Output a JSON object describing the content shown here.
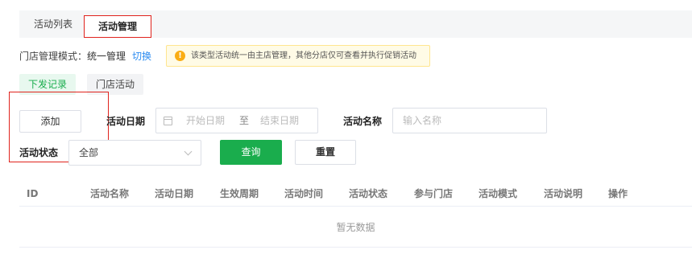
{
  "tabs": {
    "list": "活动列表",
    "manage": "活动管理"
  },
  "mode": {
    "label": "门店管理模式：",
    "value": "统一管理",
    "switch_link": "切换"
  },
  "notice": {
    "icon": "!",
    "text": "该类型活动统一由主店管理，其他分店仅可查看并执行促销活动"
  },
  "subtabs": {
    "records": "下发记录",
    "store": "门店活动"
  },
  "toolbar": {
    "add_label": "添加"
  },
  "filters": {
    "date_label": "活动日期",
    "date_start_placeholder": "开始日期",
    "date_separator": "至",
    "date_end_placeholder": "结束日期",
    "name_label": "活动名称",
    "name_placeholder": "输入名称",
    "status_label": "活动状态",
    "status_value": "全部",
    "query_label": "查询",
    "reset_label": "重置"
  },
  "table": {
    "columns": [
      "ID",
      "活动名称",
      "活动日期",
      "生效周期",
      "活动时间",
      "活动状态",
      "参与门店",
      "活动模式",
      "活动说明",
      "操作"
    ],
    "empty_text": "暂无数据"
  },
  "colors": {
    "accent": "#1aad4d",
    "link": "#2d8cf0",
    "highlight": "#e0231d",
    "warning": "#faad14"
  }
}
